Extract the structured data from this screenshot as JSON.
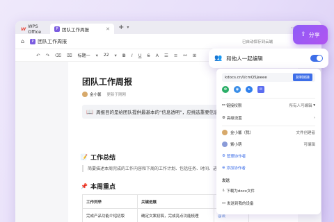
{
  "tabbar": {
    "wps_tab": "WPS Office",
    "doc_tab": "团队工作周报",
    "new_tab": "+",
    "doc_icon": "P"
  },
  "docbar": {
    "title": "团队工作周报",
    "saved": "已自动保存到云端"
  },
  "toolbar": {
    "style": "标题一",
    "size": "22"
  },
  "share": {
    "label": "分享"
  },
  "collab": {
    "label": "和他人一起编辑",
    "enabled": true
  },
  "document": {
    "title": "团队工作周报",
    "author": "金小馨",
    "updated": "更新于刚刚",
    "note": "周报目的是给团队提供最基本的“信息透明”，应挑选重要信息进行阐",
    "section1": "工作总结",
    "section1_text": "简要描述本周完成的工作内容和下周的工作计划、包括任务、时间、进度",
    "section2": "本周重点",
    "table": {
      "headers": [
        "工作列举",
        "关键进展",
        "风险"
      ],
      "rows": [
        [
          "完成产品功能介绍初版",
          "确定文案初稿，完成亮点功能梳理",
          "@流"
        ]
      ]
    }
  },
  "share_sheet": {
    "link": "kdocs.cn/l/cmQ5Jeeee",
    "copy_label": "复制链接",
    "link_perm_label": "链接权限",
    "link_perm_value": "所有人可编辑",
    "advanced": "高级设置",
    "members": [
      {
        "name": "金小馨（我）",
        "role": "文件创建者"
      },
      {
        "name": "紫小萌",
        "role": "可编辑"
      }
    ],
    "manage": "管理协作者",
    "add": "添加协作者",
    "send_section": "发送",
    "download": "下载为docx文件",
    "send_device": "发送到我的设备"
  }
}
